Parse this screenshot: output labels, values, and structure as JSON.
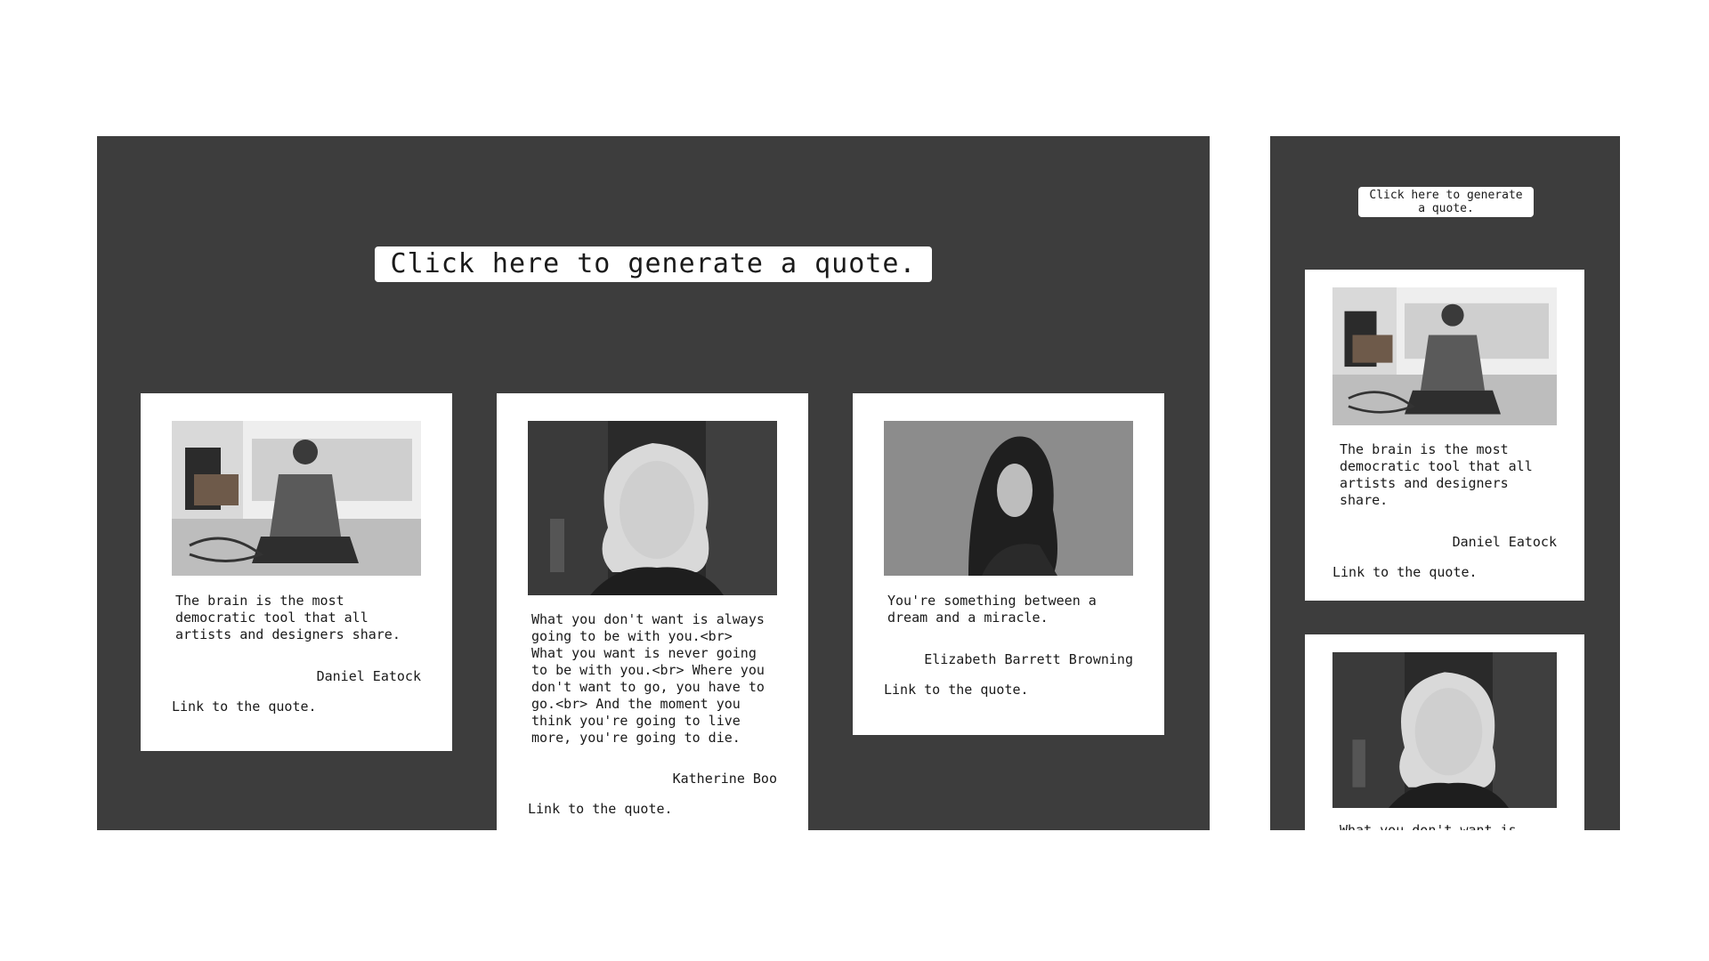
{
  "button_label": "Click here to generate a quote.",
  "link_label": "Link to the quote.",
  "quotes": [
    {
      "text": "The brain is the most\ndemocratic tool that all\nartists and designers share.",
      "author": "Daniel Eatock",
      "photo": "photo-man-sitting-on-floor"
    },
    {
      "text": "What you don't want is always\ngoing to be with you.<br>\nWhat you want is never going\nto be with you.<br> Where you\ndon't want to go, you have to\ngo.<br> And the moment you\nthink you're going to live\nmore, you're going to die.",
      "author": "Katherine Boo",
      "photo": "photo-woman-portrait"
    },
    {
      "text": "You're something between a\ndream and a miracle.",
      "author": "Elizabeth Barrett Browning",
      "photo": "photo-engraving-portrait"
    }
  ],
  "mobile": {
    "quote_1_text": "The brain is the most\ndemocratic tool that all\nartists and designers\nshare.",
    "quote_2_text_partial": "What you don't want is"
  },
  "colors": {
    "panel_background": "#3d3d3d",
    "card_background": "#ffffff",
    "text": "#1a1a1a"
  }
}
